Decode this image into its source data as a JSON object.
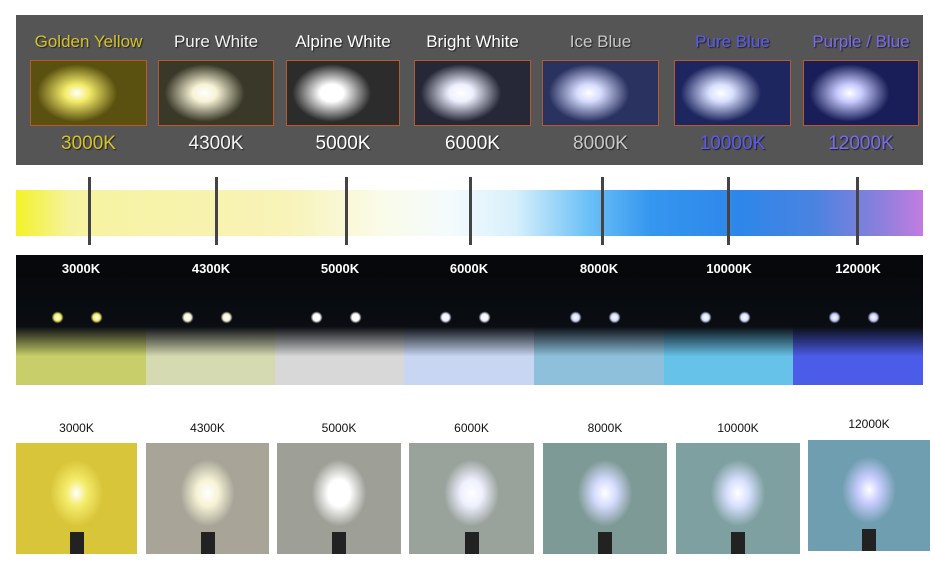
{
  "items": [
    {
      "name": "Golden Yellow",
      "kelvin": "3000K",
      "label_color": "#d6c22a",
      "glow": "#f4ec6a",
      "bg": "#5a5010",
      "night": "#c8cf6a",
      "bulb_bg": "#d9c53a"
    },
    {
      "name": "Pure White",
      "kelvin": "4300K",
      "label_color": "#f2f2f2",
      "glow": "#f6f3d6",
      "bg": "#3a3828",
      "night": "#d6dab0",
      "bulb_bg": "#a8a598"
    },
    {
      "name": "Alpine White",
      "kelvin": "5000K",
      "label_color": "#ffffff",
      "glow": "#ffffff",
      "bg": "#2c2c2c",
      "night": "#d8d8d8",
      "bulb_bg": "#9ea097"
    },
    {
      "name": "Bright White",
      "kelvin": "6000K",
      "label_color": "#ffffff",
      "glow": "#eef0ff",
      "bg": "#262838",
      "night": "#c8d6f2",
      "bulb_bg": "#9aa29c"
    },
    {
      "name": "Ice Blue",
      "kelvin": "8000K",
      "label_color": "#c8c8c8",
      "glow": "#d6dcff",
      "bg": "#2a3260",
      "night": "#8ec0dc",
      "bulb_bg": "#7e9a96"
    },
    {
      "name": "Pure Blue",
      "kelvin": "10000K",
      "label_color": "#5a5af0",
      "glow": "#d8e0ff",
      "bg": "#1e2660",
      "night": "#66c2e8",
      "bulb_bg": "#7ea0a0"
    },
    {
      "name": "Purple / Blue",
      "kelvin": "12000K",
      "label_color": "#7a6af0",
      "glow": "#c8ccff",
      "bg": "#1a1e58",
      "night": "#4a5ce8",
      "bulb_bg": "#6f9eb0"
    }
  ]
}
